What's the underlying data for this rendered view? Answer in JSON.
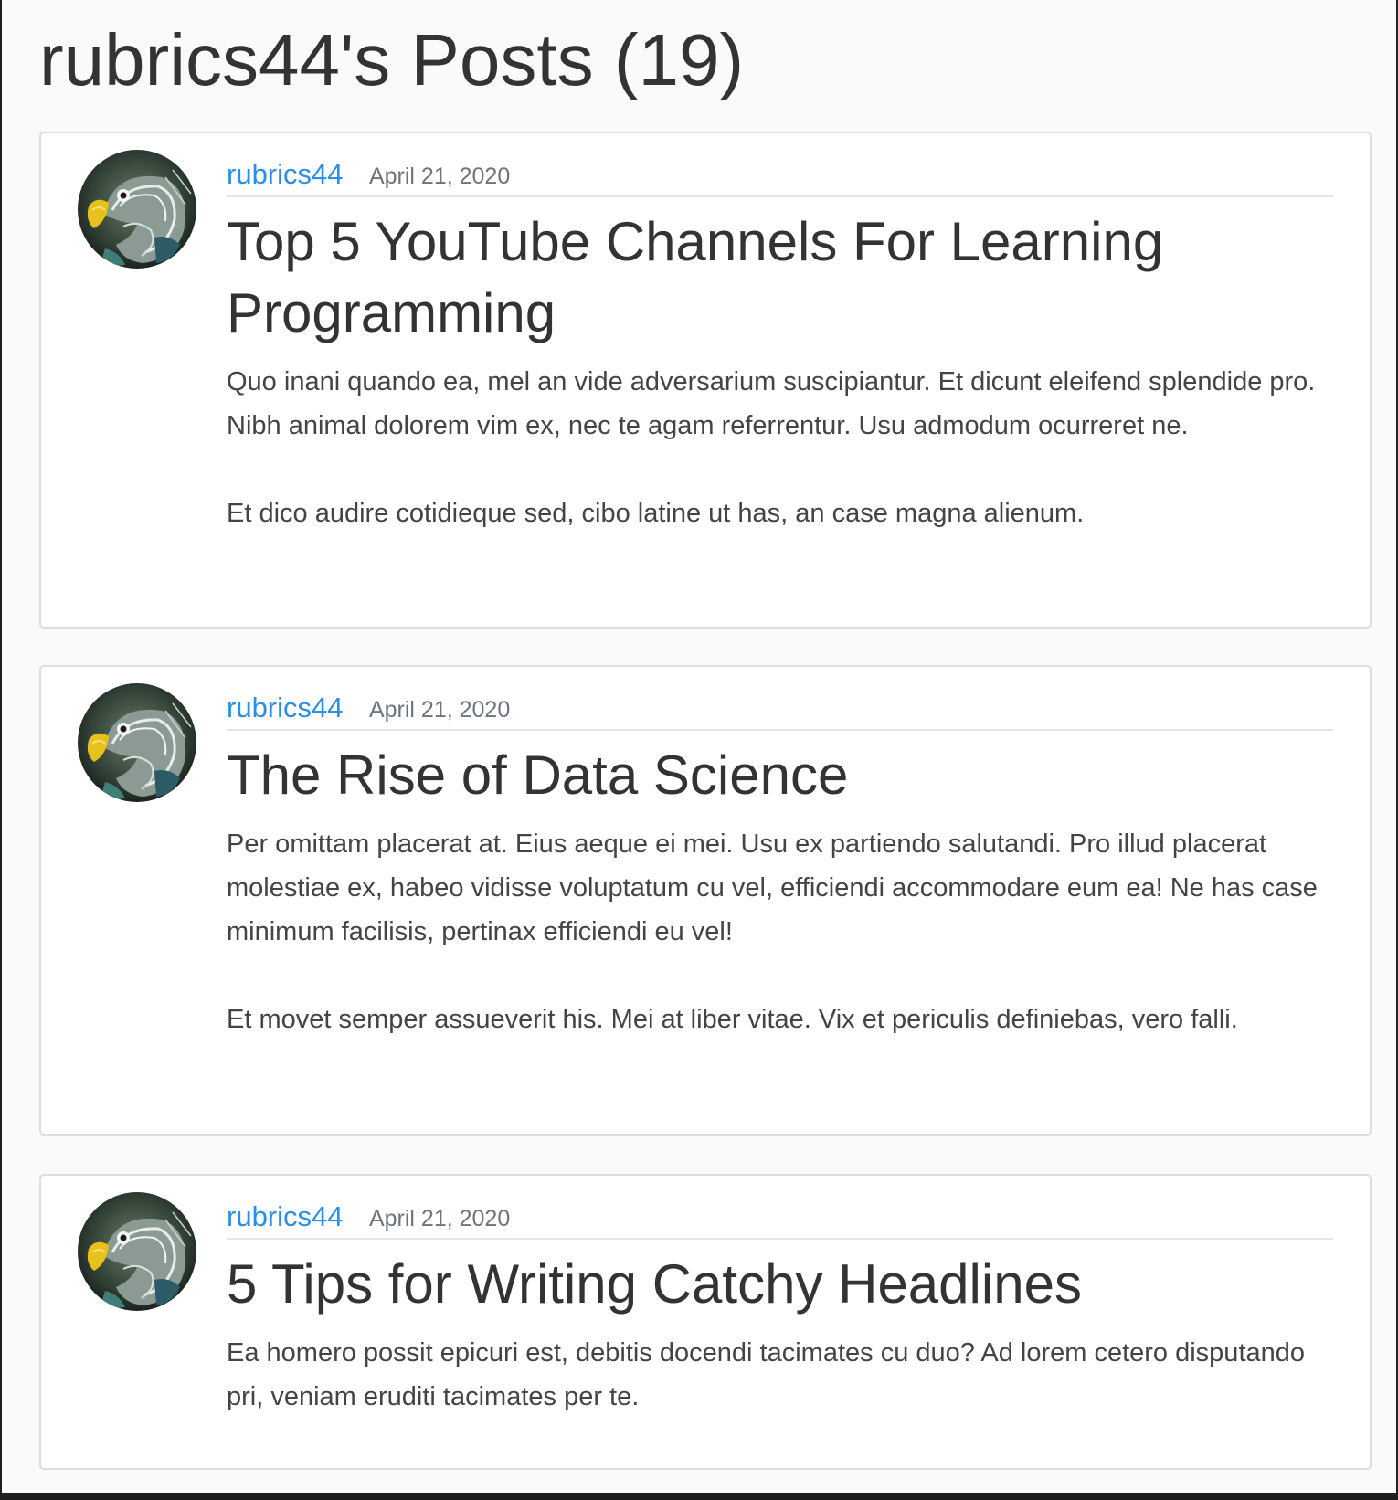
{
  "page": {
    "title": "rubrics44's Posts (19)"
  },
  "posts": [
    {
      "author": "rubrics44",
      "date": "April 21, 2020",
      "title": "Top 5 YouTube Channels For Learning Programming",
      "paragraphs": [
        "Quo inani quando ea, mel an vide adversarium suscipiantur. Et dicunt eleifend splendide pro. Nibh animal dolorem vim ex, nec te agam referrentur. Usu admodum ocurreret ne.",
        "Et dico audire cotidieque sed, cibo latine ut has, an case magna alienum."
      ]
    },
    {
      "author": "rubrics44",
      "date": "April 21, 2020",
      "title": "The Rise of Data Science",
      "paragraphs": [
        "Per omittam placerat at. Eius aeque ei mei. Usu ex partiendo salutandi. Pro illud placerat molestiae ex, habeo vidisse voluptatum cu vel, efficiendi accommodare eum ea! Ne has case minimum facilisis, pertinax efficiendi eu vel!",
        "Et movet semper assueverit his. Mei at liber vitae. Vix et periculis definiebas, vero falli."
      ]
    },
    {
      "author": "rubrics44",
      "date": "April 21, 2020",
      "title": "5 Tips for Writing Catchy Headlines",
      "paragraphs": [
        "Ea homero possit epicuri est, debitis docendi tacimates cu duo? Ad lorem cetero disputando pri, veniam eruditi tacimates per te."
      ]
    }
  ],
  "colors": {
    "author_link": "#2b8fe8",
    "text": "#333333",
    "muted": "#6c757d",
    "card_border": "#dddddd",
    "page_background": "#fafafa"
  },
  "icons": {
    "avatar": "parrot-avatar-image"
  }
}
